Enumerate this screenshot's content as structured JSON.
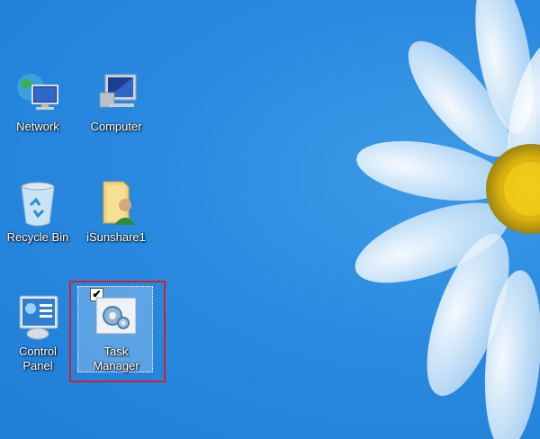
{
  "desktop": {
    "icons": [
      {
        "label": "Network",
        "icon": "network-icon"
      },
      {
        "label": "Computer",
        "icon": "computer-icon"
      },
      {
        "label": "Recycle Bin",
        "icon": "recycle-bin-icon"
      },
      {
        "label": "iSunshare1",
        "icon": "user-folder-icon"
      },
      {
        "label": "Control Panel",
        "icon": "control-panel-icon"
      },
      {
        "label": "Task Manager",
        "icon": "task-manager-icon",
        "selected": true,
        "checked": true
      }
    ],
    "checkbox_mark": "✔"
  },
  "colors": {
    "background": "#2a8ae0",
    "highlight_border": "#d0202a",
    "flower_center": "#e6c21a"
  }
}
